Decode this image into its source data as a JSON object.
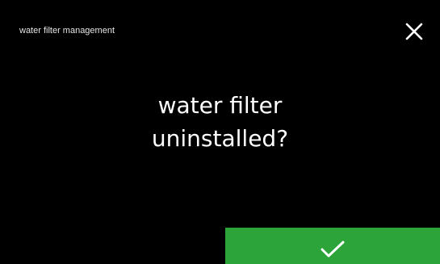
{
  "header": {
    "title": "water filter management",
    "close_icon": "close-icon"
  },
  "message": {
    "line1": "water filter",
    "line2": "uninstalled?"
  },
  "actions": {
    "confirm_icon": "checkmark-icon"
  },
  "colors": {
    "background": "#000000",
    "text": "#ffffff",
    "confirm": "#2ca43a"
  }
}
